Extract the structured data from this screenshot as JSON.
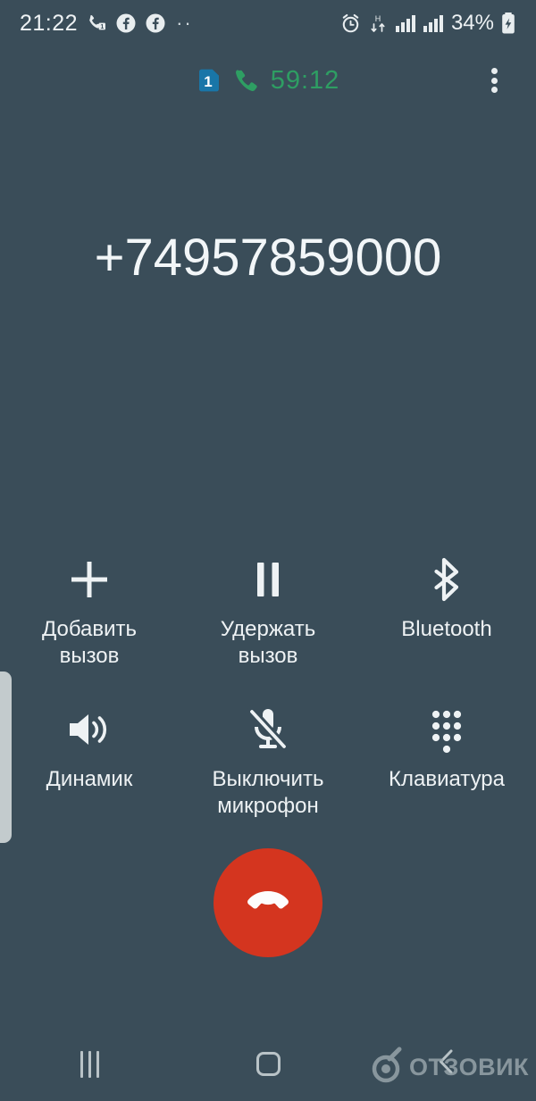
{
  "theme": {
    "background": "#3a4d59",
    "text_primary": "#f2f6f8",
    "accent_green": "#2e9e63",
    "accent_red": "#d4351f",
    "sim_blue": "#1976a8",
    "nav_icon": "#b9c3c7"
  },
  "status_bar": {
    "clock": "21:22",
    "left_icons": [
      {
        "name": "missed-call-icon",
        "badge": "1"
      },
      {
        "name": "facebook-icon"
      },
      {
        "name": "facebook-icon"
      },
      {
        "name": "more-notifications-icon",
        "glyph": "··"
      }
    ],
    "right_icons": [
      {
        "name": "alarm-icon"
      },
      {
        "name": "hspa-data-icon",
        "label": "H"
      },
      {
        "name": "signal-bars-icon-sim1"
      },
      {
        "name": "signal-bars-icon-sim2"
      }
    ],
    "battery_percent": "34%",
    "battery_charging": true
  },
  "call_header": {
    "sim_badge": "1",
    "phone_icon": "phone-handset-icon",
    "duration": "59:12",
    "overflow_menu": "more-options"
  },
  "caller": {
    "number": "+74957859000"
  },
  "controls": {
    "rows": [
      [
        {
          "id": "add-call",
          "icon": "plus-icon",
          "label": "Добавить\nвызов"
        },
        {
          "id": "hold-call",
          "icon": "pause-icon",
          "label": "Удержать\nвызов"
        },
        {
          "id": "bluetooth",
          "icon": "bluetooth-icon",
          "label": "Bluetooth"
        }
      ],
      [
        {
          "id": "speaker",
          "icon": "speaker-icon",
          "label": "Динамик"
        },
        {
          "id": "mute-mic",
          "icon": "mic-off-icon",
          "label": "Выключить\nмикрофон"
        },
        {
          "id": "keypad",
          "icon": "dialpad-icon",
          "label": "Клавиатура"
        }
      ]
    ]
  },
  "end_call": {
    "icon": "end-call-handset-icon",
    "label": "Завершить вызов"
  },
  "edge_panel": {
    "handle": "edge-panel-handle"
  },
  "nav_bar": {
    "recents": "recents-icon",
    "home": "home-icon",
    "back": "back-icon"
  },
  "watermark": {
    "text": "ОТЗОВИК"
  }
}
